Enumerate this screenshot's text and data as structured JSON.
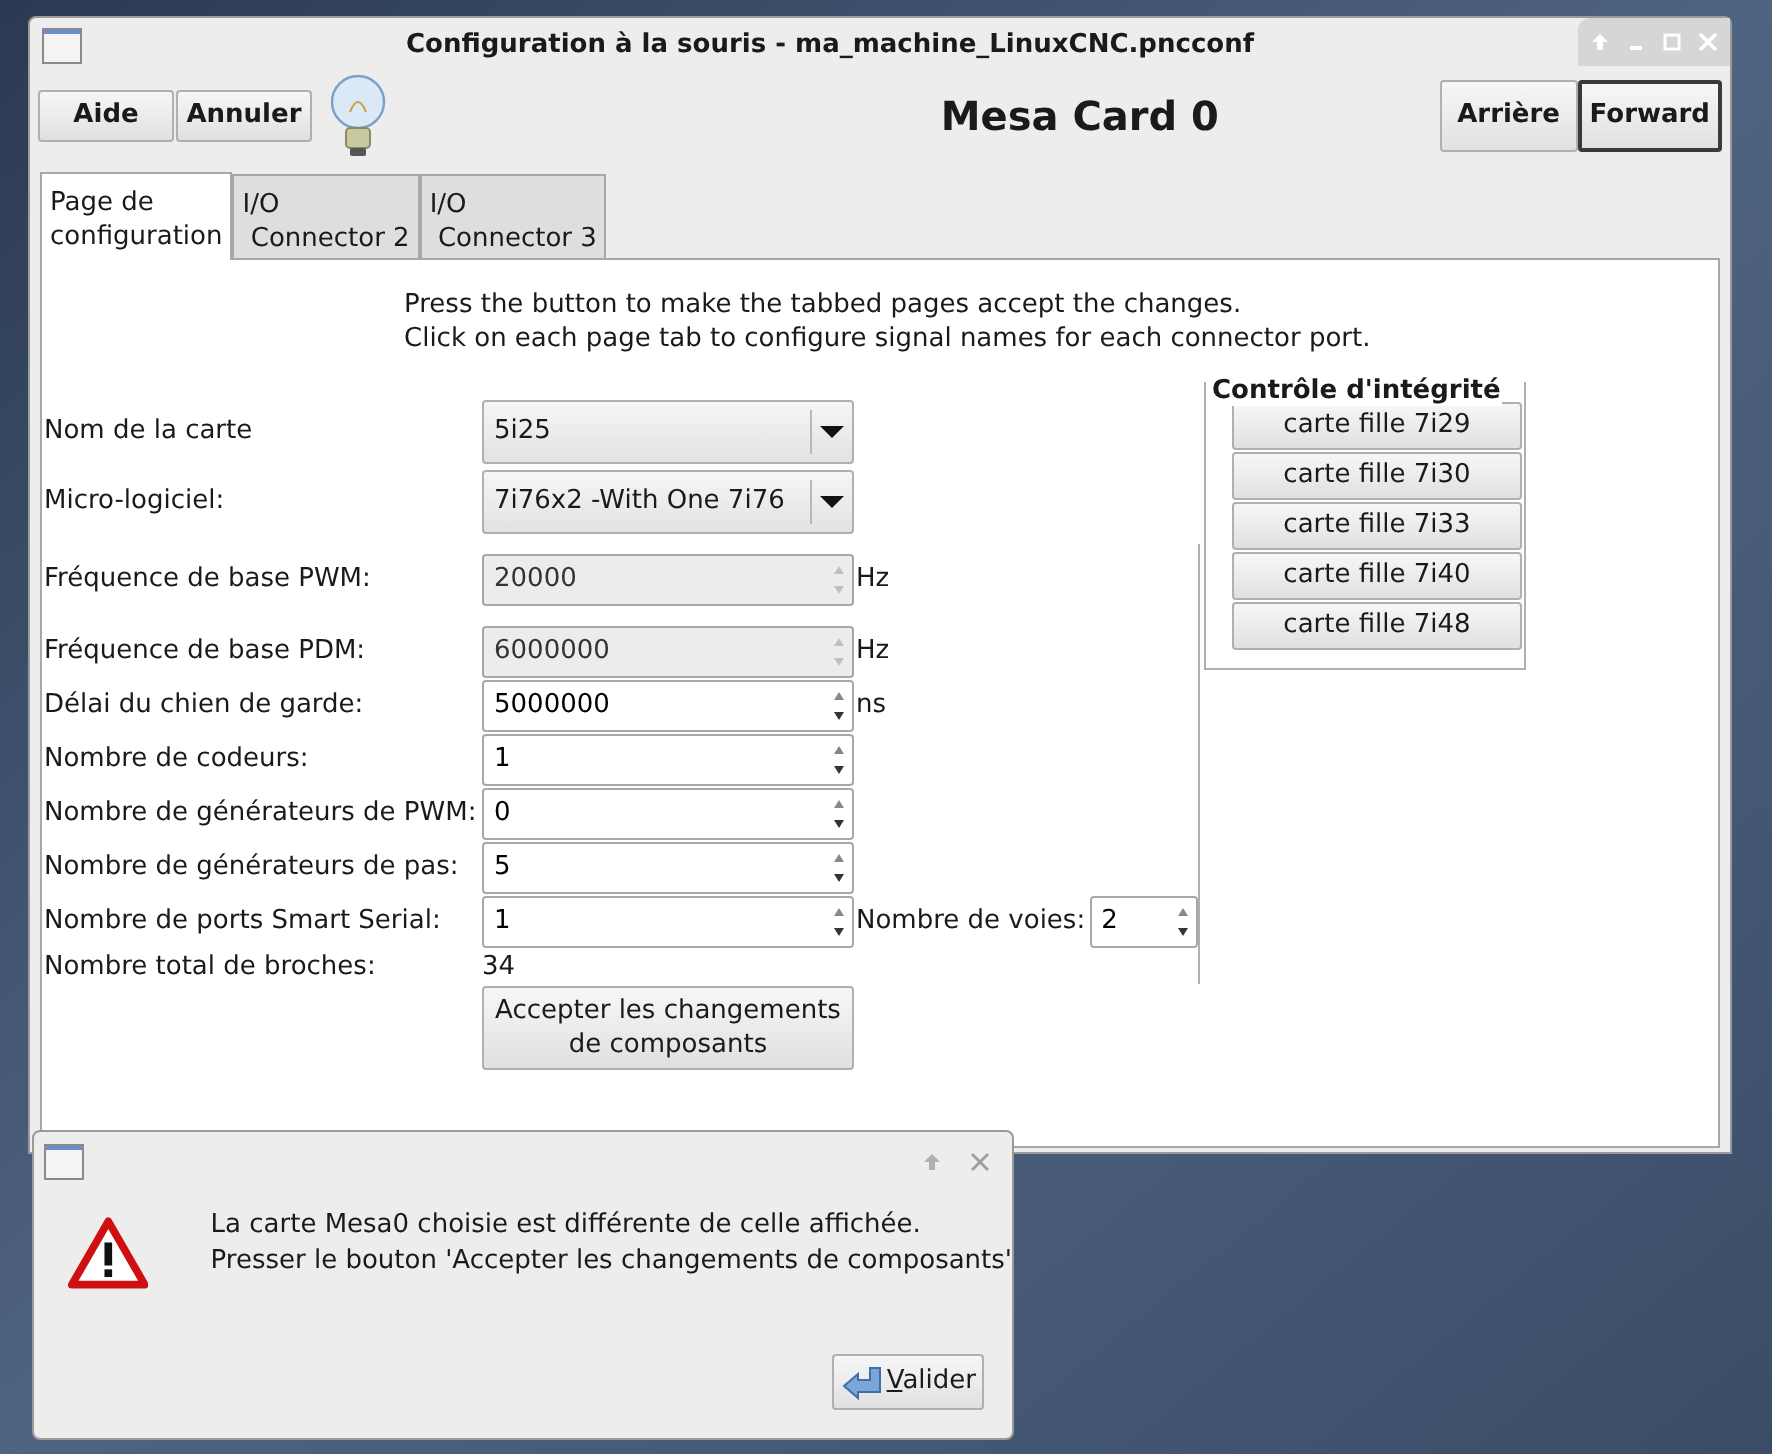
{
  "window": {
    "title": "Configuration à la souris - ma_machine_LinuxCNC.pncconf"
  },
  "toolbar": {
    "left_buttons": [
      "Aide",
      "Annuler"
    ],
    "heading": "Mesa Card 0",
    "right_buttons": [
      {
        "label": "Arrière",
        "focused": false
      },
      {
        "label": "Forward",
        "focused": true
      }
    ]
  },
  "tabs": [
    {
      "label": "Page de\nconfiguration",
      "selected": true
    },
    {
      "label": "I/O\n Connector 2",
      "selected": false
    },
    {
      "label": "I/O\n Connector 3",
      "selected": false
    }
  ],
  "instructions": [
    "Press the button to make the tabbed pages accept the changes.",
    "Click on each page tab to configure signal names for each connector port."
  ],
  "form": [
    {
      "kind": "combo",
      "label": "Nom de la carte",
      "value": "5i25"
    },
    {
      "kind": "combo",
      "label": "Micro-logiciel:",
      "value": "7i76x2 -With One 7i76"
    },
    {
      "kind": "spin",
      "label": "Fréquence de base PWM:",
      "value": "20000",
      "unit": "Hz",
      "disabled": true
    },
    {
      "kind": "spin",
      "label": "Fréquence de base PDM:",
      "value": "6000000",
      "unit": "Hz",
      "disabled": true
    },
    {
      "kind": "spin",
      "label": "Délai du chien de garde:",
      "value": "5000000",
      "unit": "ns",
      "disabled": false
    },
    {
      "kind": "spin",
      "label": "Nombre de codeurs:",
      "value": "1",
      "disabled": false
    },
    {
      "kind": "spin",
      "label": "Nombre de générateurs de PWM:",
      "value": "0",
      "disabled": false
    },
    {
      "kind": "spin",
      "label": "Nombre de générateurs de pas:",
      "value": "5",
      "disabled": false
    },
    {
      "kind": "spin",
      "label": "Nombre de ports Smart Serial:",
      "value": "1",
      "disabled": false,
      "extra_label": "Nombre de voies:",
      "extra_value": "2"
    },
    {
      "kind": "text",
      "label": "Nombre total de broches:",
      "value": "34"
    }
  ],
  "accept_button": "Accepter les changements\nde composants",
  "integrity": {
    "title": "Contrôle d'intégrité",
    "buttons": [
      "carte fille 7i29",
      "carte fille 7i30",
      "carte fille 7i33",
      "carte fille 7i40",
      "carte fille 7i48"
    ]
  },
  "dialog": {
    "message": "La carte Mesa0 choisie est différente de celle affichée.\nPresser le bouton 'Accepter les changements de composants'",
    "button": "Valider"
  }
}
